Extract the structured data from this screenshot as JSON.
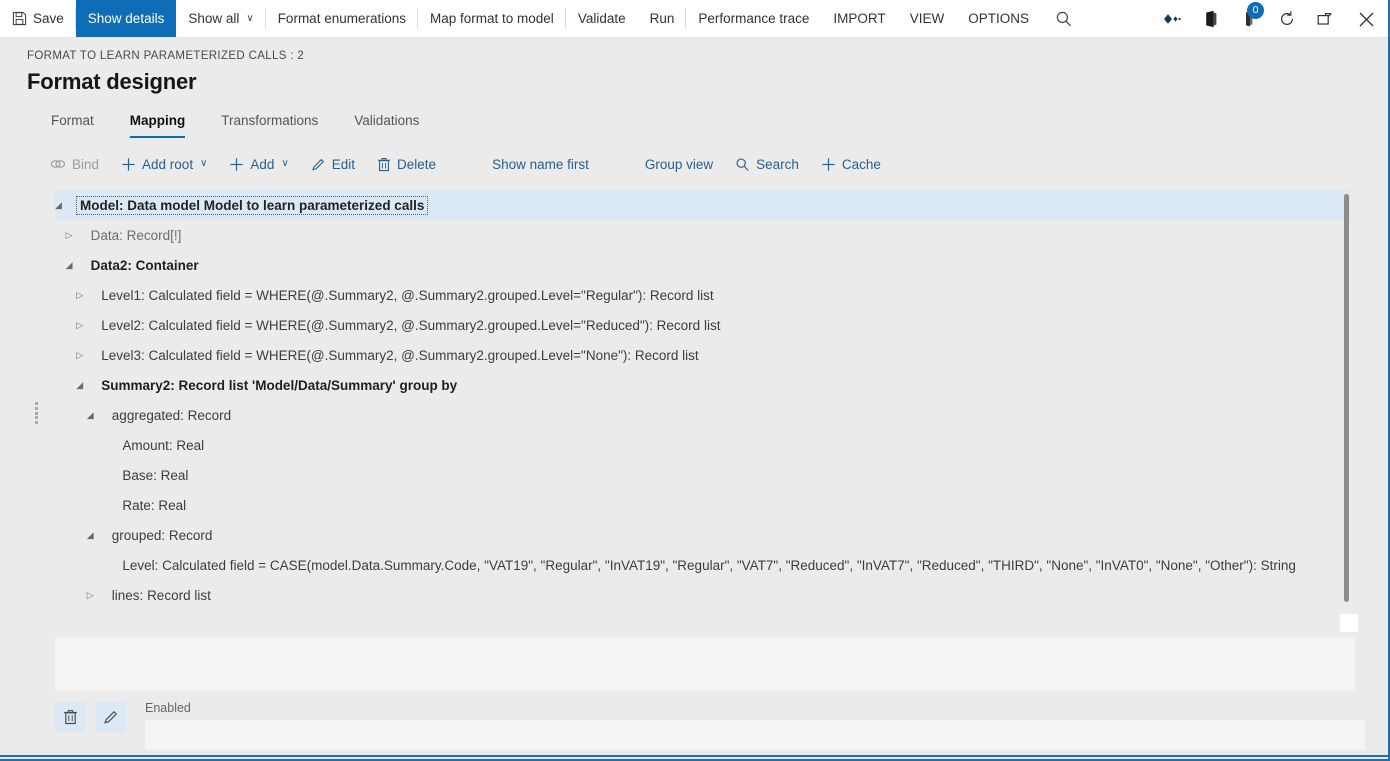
{
  "topbar": {
    "save_label": "Save",
    "items": [
      {
        "label": "Show details",
        "active": true
      },
      {
        "label": "Show all",
        "caret": "∨"
      },
      {
        "label": "Format enumerations"
      },
      {
        "label": "Map format to model"
      },
      {
        "label": "Validate"
      },
      {
        "label": "Run"
      },
      {
        "label": "Performance trace"
      },
      {
        "label": "IMPORT"
      },
      {
        "label": "VIEW"
      },
      {
        "label": "OPTIONS"
      }
    ],
    "icons": {
      "search": "search-icon",
      "diamond": "diamond-link-icon",
      "office": "office-app-icon",
      "notifications": "notification-icon",
      "notification_count": "0",
      "refresh": "refresh-icon",
      "restore": "restore-window-icon",
      "close": "close-icon"
    }
  },
  "header": {
    "breadcrumb": "FORMAT TO LEARN PARAMETERIZED CALLS : 2",
    "title": "Format designer"
  },
  "tabs": [
    {
      "label": "Format",
      "selected": false
    },
    {
      "label": "Mapping",
      "selected": true
    },
    {
      "label": "Transformations",
      "selected": false
    },
    {
      "label": "Validations",
      "selected": false
    }
  ],
  "actions": [
    {
      "label": "Bind",
      "icon": "bind-icon",
      "disabled": true
    },
    {
      "label": "Add root",
      "icon": "plus-icon",
      "caret": "∨"
    },
    {
      "label": "Add",
      "icon": "plus-icon",
      "caret": "∨"
    },
    {
      "label": "Edit",
      "icon": "pencil-icon"
    },
    {
      "label": "Delete",
      "icon": "trash-icon"
    },
    {
      "label": "Show name first",
      "icon": "none"
    },
    {
      "label": "Group view",
      "icon": "none"
    },
    {
      "label": "Search",
      "icon": "search-icon"
    },
    {
      "label": "Cache",
      "icon": "plus-icon"
    }
  ],
  "tree": [
    {
      "label": "Model: Data model Model to learn parameterized calls",
      "indent": 0,
      "twist": "expanded",
      "selected": true,
      "style": "bold"
    },
    {
      "label": "Data: Record[!]",
      "indent": 1,
      "twist": "collapsed",
      "selected": false,
      "style": "muted"
    },
    {
      "label": "Data2: Container",
      "indent": 1,
      "twist": "expanded",
      "selected": false,
      "style": "bold"
    },
    {
      "label": "Level1: Calculated field = WHERE(@.Summary2, @.Summary2.grouped.Level=\"Regular\"): Record list",
      "indent": 2,
      "twist": "collapsed",
      "selected": false,
      "style": "normal"
    },
    {
      "label": "Level2: Calculated field = WHERE(@.Summary2, @.Summary2.grouped.Level=\"Reduced\"): Record list",
      "indent": 2,
      "twist": "collapsed",
      "selected": false,
      "style": "normal"
    },
    {
      "label": "Level3: Calculated field = WHERE(@.Summary2, @.Summary2.grouped.Level=\"None\"): Record list",
      "indent": 2,
      "twist": "collapsed",
      "selected": false,
      "style": "normal"
    },
    {
      "label": "Summary2: Record list 'Model/Data/Summary' group by",
      "indent": 2,
      "twist": "expanded",
      "selected": false,
      "style": "bold"
    },
    {
      "label": "aggregated: Record",
      "indent": 3,
      "twist": "expanded",
      "selected": false,
      "style": "normal"
    },
    {
      "label": "Amount: Real",
      "indent": 4,
      "twist": "none",
      "selected": false,
      "style": "normal"
    },
    {
      "label": "Base: Real",
      "indent": 4,
      "twist": "none",
      "selected": false,
      "style": "normal"
    },
    {
      "label": "Rate: Real",
      "indent": 4,
      "twist": "none",
      "selected": false,
      "style": "normal"
    },
    {
      "label": "grouped: Record",
      "indent": 3,
      "twist": "expanded",
      "selected": false,
      "style": "normal"
    },
    {
      "label": "Level: Calculated field = CASE(model.Data.Summary.Code, \"VAT19\", \"Regular\", \"InVAT19\", \"Regular\", \"VAT7\", \"Reduced\", \"InVAT7\", \"Reduced\", \"THIRD\", \"None\", \"InVAT0\", \"None\", \"Other\"): String",
      "indent": 4,
      "twist": "none",
      "selected": false,
      "style": "normal"
    },
    {
      "label": "lines: Record list",
      "indent": 3,
      "twist": "collapsed",
      "selected": false,
      "style": "normal"
    }
  ],
  "footer": {
    "delete_icon": "trash-icon",
    "edit_icon": "pencil-icon",
    "field_label": "Enabled",
    "field_value": "",
    "field_placeholder": ""
  },
  "colors": {
    "accent": "#0f6cb6",
    "selection": "#dbe9f7",
    "page_bg": "#ebebeb",
    "link": "#2a5e8e"
  }
}
